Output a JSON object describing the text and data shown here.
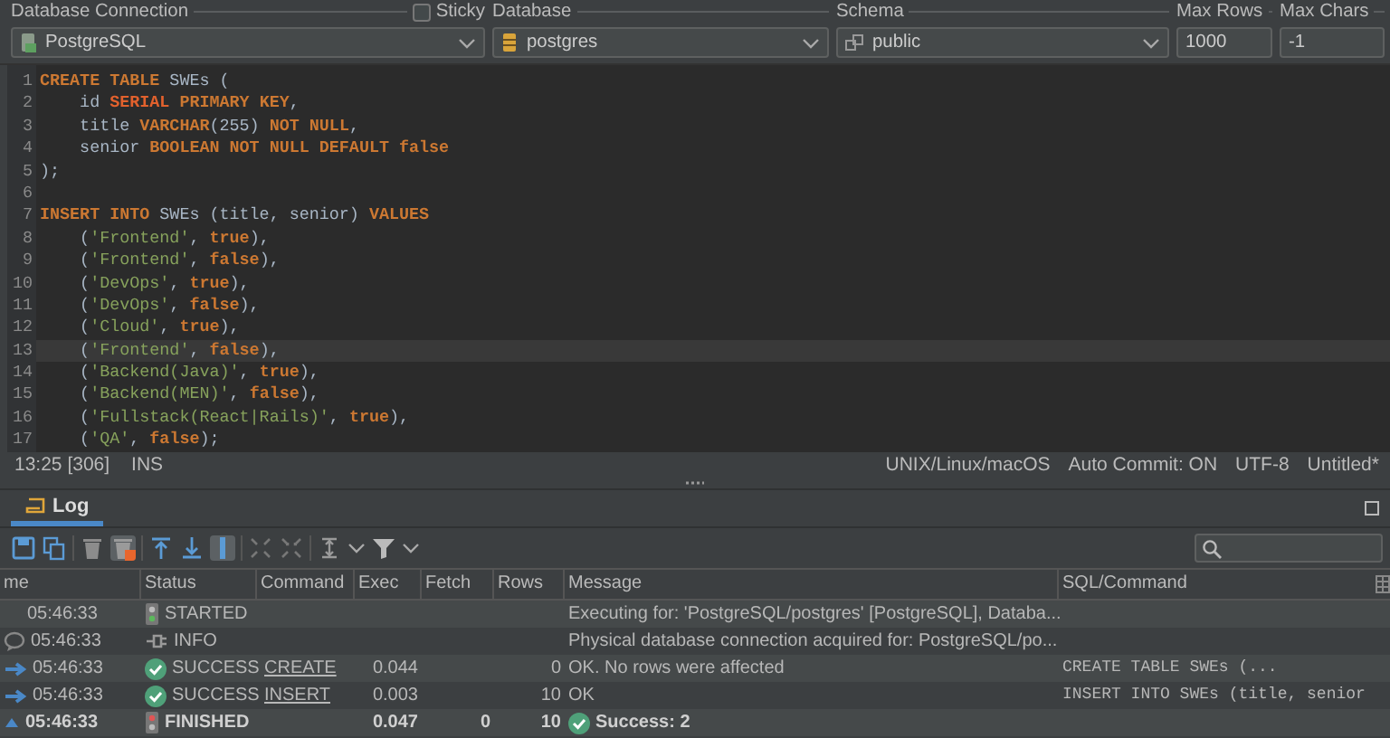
{
  "toolbar": {
    "connection": {
      "label": "Database Connection",
      "value": "PostgreSQL"
    },
    "sticky": {
      "label": "Sticky",
      "checked": false
    },
    "database": {
      "label": "Database",
      "value": "postgres"
    },
    "schema": {
      "label": "Schema",
      "value": "public"
    },
    "max_rows": {
      "label": "Max Rows",
      "value": "1000"
    },
    "max_chars": {
      "label": "Max Chars",
      "value": "-1"
    }
  },
  "editor": {
    "lines": [
      {
        "number": "1",
        "current": false,
        "tokens": [
          {
            "kind": "kw",
            "text": "CREATE TABLE"
          },
          {
            "kind": "plain",
            "text": " SWEs ("
          }
        ]
      },
      {
        "number": "2",
        "current": false,
        "tokens": [
          {
            "kind": "plain",
            "text": "    id "
          },
          {
            "kind": "type",
            "text": "SERIAL"
          },
          {
            "kind": "kw",
            "text": " PRIMARY KEY"
          },
          {
            "kind": "plain",
            "text": ","
          }
        ]
      },
      {
        "number": "3",
        "current": false,
        "tokens": [
          {
            "kind": "plain",
            "text": "    title "
          },
          {
            "kind": "kw",
            "text": "VARCHAR"
          },
          {
            "kind": "plain",
            "text": "(255) "
          },
          {
            "kind": "kw",
            "text": "NOT NULL"
          },
          {
            "kind": "plain",
            "text": ","
          }
        ]
      },
      {
        "number": "4",
        "current": false,
        "tokens": [
          {
            "kind": "plain",
            "text": "    senior "
          },
          {
            "kind": "kw",
            "text": "BOOLEAN NOT NULL DEFAULT false"
          }
        ]
      },
      {
        "number": "5",
        "current": false,
        "tokens": [
          {
            "kind": "plain",
            "text": ");"
          }
        ]
      },
      {
        "number": "6",
        "current": false
      },
      {
        "number": "7",
        "current": false,
        "tokens": [
          {
            "kind": "kw",
            "text": "INSERT INTO"
          },
          {
            "kind": "plain",
            "text": " SWEs (title, senior) "
          },
          {
            "kind": "kw",
            "text": "VALUES"
          }
        ]
      },
      {
        "number": "8",
        "current": false,
        "tokens": [
          {
            "kind": "plain",
            "text": "    ("
          },
          {
            "kind": "str",
            "text": "'Frontend'"
          },
          {
            "kind": "plain",
            "text": ", "
          },
          {
            "kind": "kw",
            "text": "true"
          },
          {
            "kind": "plain",
            "text": "),"
          }
        ]
      },
      {
        "number": "9",
        "current": false,
        "tokens": [
          {
            "kind": "plain",
            "text": "    ("
          },
          {
            "kind": "str",
            "text": "'Frontend'"
          },
          {
            "kind": "plain",
            "text": ", "
          },
          {
            "kind": "kw",
            "text": "false"
          },
          {
            "kind": "plain",
            "text": "),"
          }
        ]
      },
      {
        "number": "10",
        "current": false,
        "tokens": [
          {
            "kind": "plain",
            "text": "    ("
          },
          {
            "kind": "str",
            "text": "'DevOps'"
          },
          {
            "kind": "plain",
            "text": ", "
          },
          {
            "kind": "kw",
            "text": "true"
          },
          {
            "kind": "plain",
            "text": "),"
          }
        ]
      },
      {
        "number": "11",
        "current": false,
        "tokens": [
          {
            "kind": "plain",
            "text": "    ("
          },
          {
            "kind": "str",
            "text": "'DevOps'"
          },
          {
            "kind": "plain",
            "text": ", "
          },
          {
            "kind": "kw",
            "text": "false"
          },
          {
            "kind": "plain",
            "text": "),"
          }
        ]
      },
      {
        "number": "12",
        "current": false,
        "tokens": [
          {
            "kind": "plain",
            "text": "    ("
          },
          {
            "kind": "str",
            "text": "'Cloud'"
          },
          {
            "kind": "plain",
            "text": ", "
          },
          {
            "kind": "kw",
            "text": "true"
          },
          {
            "kind": "plain",
            "text": "),"
          }
        ]
      },
      {
        "number": "13",
        "current": true,
        "tokens": [
          {
            "kind": "plain",
            "text": "    ("
          },
          {
            "kind": "str",
            "text": "'Frontend'"
          },
          {
            "kind": "plain",
            "text": ", "
          },
          {
            "kind": "kw",
            "text": "false"
          },
          {
            "kind": "plain",
            "text": "),"
          }
        ]
      },
      {
        "number": "14",
        "current": false,
        "tokens": [
          {
            "kind": "plain",
            "text": "    ("
          },
          {
            "kind": "str",
            "text": "'Backend(Java)'"
          },
          {
            "kind": "plain",
            "text": ", "
          },
          {
            "kind": "kw",
            "text": "true"
          },
          {
            "kind": "plain",
            "text": "),"
          }
        ]
      },
      {
        "number": "15",
        "current": false,
        "tokens": [
          {
            "kind": "plain",
            "text": "    ("
          },
          {
            "kind": "str",
            "text": "'Backend(MEN)'"
          },
          {
            "kind": "plain",
            "text": ", "
          },
          {
            "kind": "kw",
            "text": "false"
          },
          {
            "kind": "plain",
            "text": "),"
          }
        ]
      },
      {
        "number": "16",
        "current": false,
        "tokens": [
          {
            "kind": "plain",
            "text": "    ("
          },
          {
            "kind": "str",
            "text": "'Fullstack(React|Rails)'"
          },
          {
            "kind": "plain",
            "text": ", "
          },
          {
            "kind": "kw",
            "text": "true"
          },
          {
            "kind": "plain",
            "text": "),"
          }
        ]
      },
      {
        "number": "17",
        "current": false,
        "tokens": [
          {
            "kind": "plain",
            "text": "    ("
          },
          {
            "kind": "str",
            "text": "'QA'"
          },
          {
            "kind": "plain",
            "text": ", "
          },
          {
            "kind": "kw",
            "text": "false"
          },
          {
            "kind": "plain",
            "text": ");"
          }
        ]
      }
    ]
  },
  "status_bar": {
    "position": "13:25 [306]",
    "mode": "INS",
    "items": [
      "UNIX/Linux/macOS",
      "Auto Commit: ON",
      "UTF-8",
      "Untitled*"
    ]
  },
  "log": {
    "tabs": [
      {
        "label": "Log",
        "selected": true
      }
    ],
    "table": {
      "columns": [
        "me",
        "Status",
        "Command",
        "Exec",
        "Fetch",
        "Rows",
        "Message",
        "SQL/Command"
      ],
      "rows": [
        {
          "kind": "started",
          "time": "05:46:33",
          "status": "STARTED",
          "command": "",
          "exec": "",
          "fetch": "",
          "rows": "",
          "message": "Executing for: 'PostgreSQL/postgres' [PostgreSQL], Databa...",
          "sql": ""
        },
        {
          "kind": "info",
          "time": "05:46:33",
          "status": "INFO",
          "command": "",
          "exec": "",
          "fetch": "",
          "rows": "",
          "message": "Physical database connection acquired for: PostgreSQL/po...",
          "sql": ""
        },
        {
          "kind": "success",
          "time": "05:46:33",
          "status": "SUCCESS",
          "command": "CREATE",
          "exec": "0.044",
          "fetch": "",
          "rows": "0",
          "message": "OK. No rows were affected",
          "sql": "CREATE TABLE SWEs (..."
        },
        {
          "kind": "success",
          "time": "05:46:33",
          "status": "SUCCESS",
          "command": "INSERT",
          "exec": "0.003",
          "fetch": "",
          "rows": "10",
          "message": "OK",
          "sql": "INSERT INTO SWEs (title, senior"
        },
        {
          "kind": "finished",
          "time": "05:46:33",
          "status": "FINISHED",
          "command": "",
          "exec": "0.047",
          "fetch": "0",
          "rows": "10",
          "message": "Success: 2",
          "sql": ""
        }
      ]
    }
  }
}
